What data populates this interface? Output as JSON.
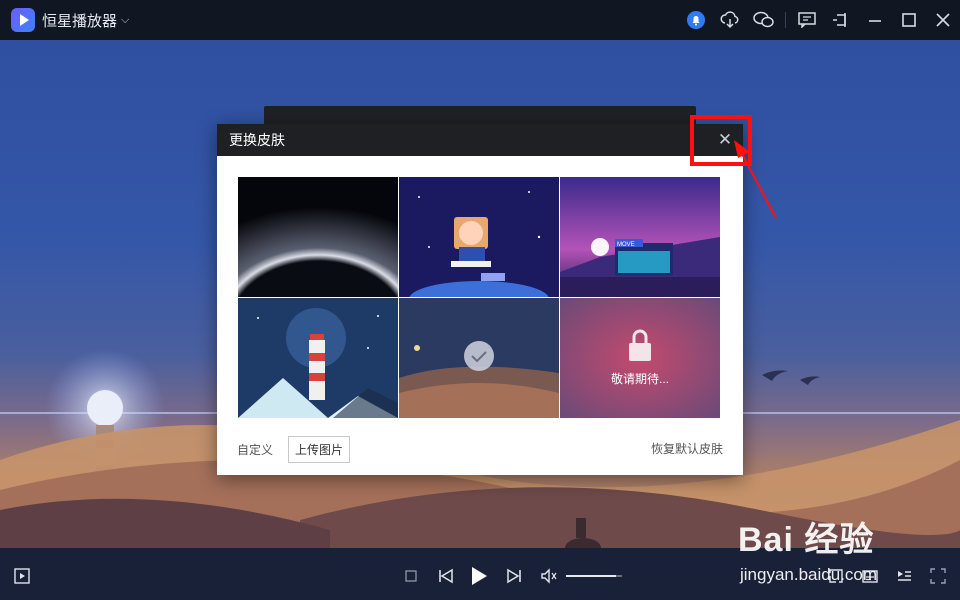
{
  "app": {
    "title": "恒星播放器",
    "title_dropdown_icon": "chevron-down-icon"
  },
  "titlebar_icons": [
    "bell-icon",
    "cloud-download-icon",
    "wechat-icon",
    "feedback-icon",
    "pin-icon",
    "minimize-icon",
    "maximize-icon",
    "close-icon"
  ],
  "dialog": {
    "title": "更换皮肤",
    "close_icon": "close-icon",
    "skins": [
      {
        "name": "space-horizon",
        "selected": false,
        "locked": false
      },
      {
        "name": "astronaut-reader",
        "selected": false,
        "locked": false
      },
      {
        "name": "movie-theater",
        "selected": false,
        "locked": false
      },
      {
        "name": "lighthouse",
        "selected": false,
        "locked": false
      },
      {
        "name": "desert-camel",
        "selected": true,
        "locked": false
      },
      {
        "name": "locked-coming-soon",
        "selected": false,
        "locked": true
      }
    ],
    "locked_text": "敬请期待...",
    "movie_sign": "MOVE",
    "custom_label": "自定义",
    "upload_button": "上传图片",
    "restore_default": "恢复默认皮肤"
  },
  "controlbar_icons": [
    "playlist-icon",
    "stop-icon",
    "previous-icon",
    "play-icon",
    "next-icon",
    "volume-icon",
    "loop-icon",
    "subtitle-icon",
    "settings-icon",
    "fullscreen-icon"
  ],
  "volume_level": 0.9,
  "watermark": {
    "brand": "Bai 经验",
    "site": "jingyan.baidu.com"
  },
  "colors": {
    "annotation": "#ff1010",
    "titlebar": "#111722",
    "dialog_header": "#1f2024"
  }
}
